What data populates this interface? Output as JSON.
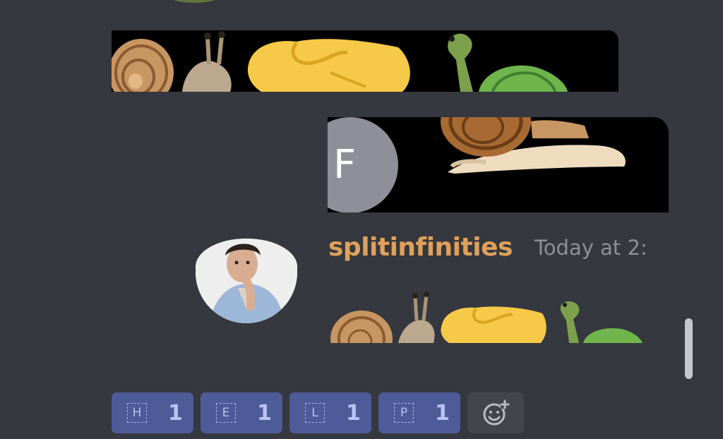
{
  "message_top": {
    "emojis": [
      "snail-shell",
      "snail",
      "handshake",
      "turtle"
    ]
  },
  "quoted_message": {
    "avatar_initial": "F",
    "emojis": [
      "snail"
    ]
  },
  "message": {
    "username": "splitinfinities",
    "timestamp": "Today at 2:",
    "emojis": [
      "snail-shell",
      "snail",
      "handshake",
      "turtle"
    ]
  },
  "reactions": [
    {
      "glyph": "H",
      "count": "1"
    },
    {
      "glyph": "E",
      "count": "1"
    },
    {
      "glyph": "L",
      "count": "1"
    },
    {
      "glyph": "P",
      "count": "1"
    }
  ],
  "add_reaction": {
    "icon": "add-reaction-icon"
  },
  "colors": {
    "background": "#35383e",
    "username": "#e0a05a",
    "reaction_bg": "#4e5b99",
    "reaction_text": "#b9c4f5",
    "avatar_gray": "#8e8f98"
  }
}
